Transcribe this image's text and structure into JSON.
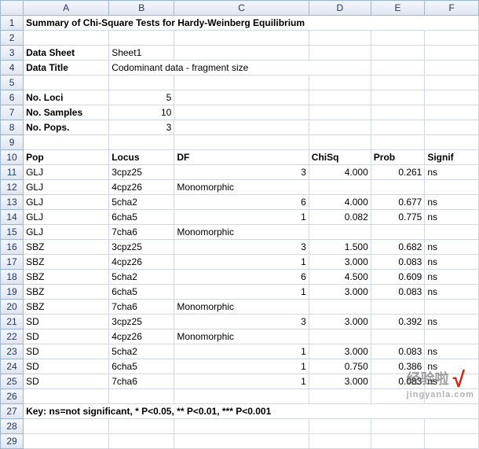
{
  "columns": [
    "A",
    "B",
    "C",
    "D",
    "E",
    "F"
  ],
  "rowCount": 29,
  "title": "Summary of Chi-Square Tests for Hardy-Weinberg Equilibrium",
  "labels": {
    "dataSheet": "Data Sheet",
    "dataSheetVal": "Sheet1",
    "dataTitle": "Data Title",
    "dataTitleVal": "Codominant data - fragment size",
    "noLoci": "No. Loci",
    "noLociVal": "5",
    "noSamples": "No. Samples",
    "noSamplesVal": "10",
    "noPops": "No. Pops.",
    "noPopsVal": "3"
  },
  "headers": {
    "pop": "Pop",
    "locus": "Locus",
    "df": "DF",
    "chisq": "ChiSq",
    "prob": "Prob",
    "signif": "Signif"
  },
  "rows": [
    {
      "pop": "GLJ",
      "locus": "3cpz25",
      "df": "3",
      "chisq": "4.000",
      "prob": "0.261",
      "signif": "ns"
    },
    {
      "pop": "GLJ",
      "locus": "4cpz26",
      "df": "Monomorphic",
      "chisq": "",
      "prob": "",
      "signif": ""
    },
    {
      "pop": "GLJ",
      "locus": "5cha2",
      "df": "6",
      "chisq": "4.000",
      "prob": "0.677",
      "signif": "ns"
    },
    {
      "pop": "GLJ",
      "locus": "6cha5",
      "df": "1",
      "chisq": "0.082",
      "prob": "0.775",
      "signif": "ns"
    },
    {
      "pop": "GLJ",
      "locus": "7cha6",
      "df": "Monomorphic",
      "chisq": "",
      "prob": "",
      "signif": ""
    },
    {
      "pop": "SBZ",
      "locus": "3cpz25",
      "df": "3",
      "chisq": "1.500",
      "prob": "0.682",
      "signif": "ns"
    },
    {
      "pop": "SBZ",
      "locus": "4cpz26",
      "df": "1",
      "chisq": "3.000",
      "prob": "0.083",
      "signif": "ns"
    },
    {
      "pop": "SBZ",
      "locus": "5cha2",
      "df": "6",
      "chisq": "4.500",
      "prob": "0.609",
      "signif": "ns"
    },
    {
      "pop": "SBZ",
      "locus": "6cha5",
      "df": "1",
      "chisq": "3.000",
      "prob": "0.083",
      "signif": "ns"
    },
    {
      "pop": "SBZ",
      "locus": "7cha6",
      "df": "Monomorphic",
      "chisq": "",
      "prob": "",
      "signif": ""
    },
    {
      "pop": "SD",
      "locus": "3cpz25",
      "df": "3",
      "chisq": "3.000",
      "prob": "0.392",
      "signif": "ns"
    },
    {
      "pop": "SD",
      "locus": "4cpz26",
      "df": "Monomorphic",
      "chisq": "",
      "prob": "",
      "signif": ""
    },
    {
      "pop": "SD",
      "locus": "5cha2",
      "df": "1",
      "chisq": "3.000",
      "prob": "0.083",
      "signif": "ns"
    },
    {
      "pop": "SD",
      "locus": "6cha5",
      "df": "1",
      "chisq": "0.750",
      "prob": "0.386",
      "signif": "ns"
    },
    {
      "pop": "SD",
      "locus": "7cha6",
      "df": "1",
      "chisq": "3.000",
      "prob": "0.083",
      "signif": "ns"
    }
  ],
  "key": "Key: ns=not significant, * P<0.05, ** P<0.01, *** P<0.001",
  "watermark": {
    "brand": "经验啦",
    "check": "√",
    "url": "jingyanla.com"
  }
}
